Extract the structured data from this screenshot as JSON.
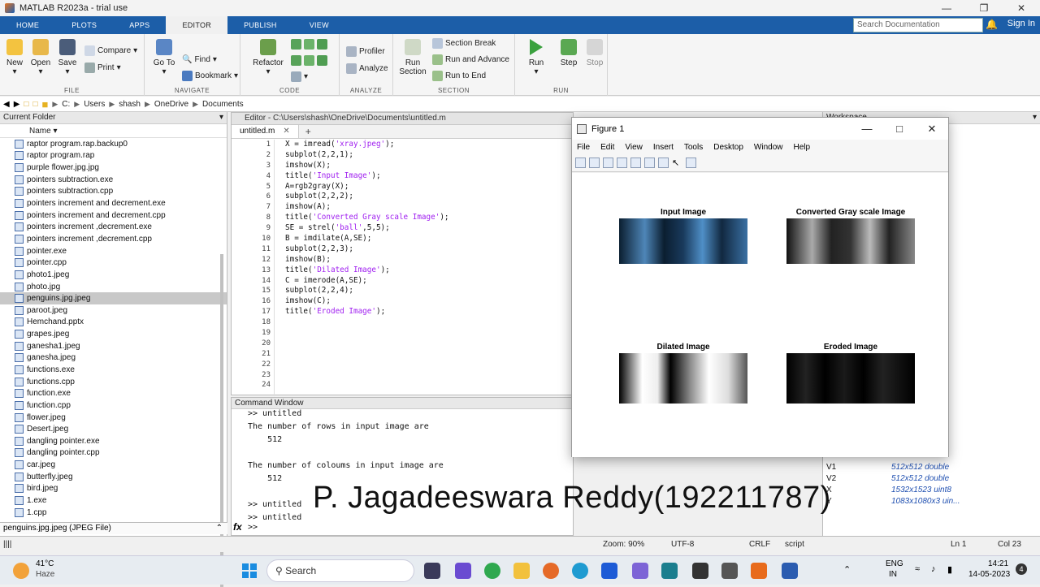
{
  "app": {
    "title": "MATLAB R2023a - trial use"
  },
  "tabs": [
    "HOME",
    "PLOTS",
    "APPS",
    "EDITOR",
    "PUBLISH",
    "VIEW"
  ],
  "search_placeholder": "Search Documentation",
  "sign_in": "Sign In",
  "ribbon": {
    "file": {
      "label": "FILE",
      "new": "New",
      "open": "Open",
      "save": "Save",
      "compare": "Compare",
      "print": "Print"
    },
    "navigate": {
      "label": "NAVIGATE",
      "goto": "Go To",
      "find": "Find",
      "bookmark": "Bookmark"
    },
    "code": {
      "label": "CODE",
      "refactor": "Refactor"
    },
    "analyze": {
      "label": "ANALYZE",
      "profiler": "Profiler",
      "analyze": "Analyze"
    },
    "section": {
      "label": "SECTION",
      "run_section": "Run\nSection",
      "section_break": "Section Break",
      "run_advance": "Run and Advance",
      "run_end": "Run to End"
    },
    "run": {
      "label": "RUN",
      "run": "Run",
      "step": "Step",
      "stop": "Stop"
    }
  },
  "address": [
    "C:",
    "Users",
    "shash",
    "OneDrive",
    "Documents"
  ],
  "current_folder": {
    "title": "Current Folder",
    "col": "Name",
    "files": [
      "raptor program.rap.backup0",
      "raptor program.rap",
      "purple flower.jpg.jpg",
      "pointers subtraction.exe",
      "pointers subtraction.cpp",
      "pointers increment and decrement.exe",
      "pointers increment and decrement.cpp",
      "pointers increment ,decrement.exe",
      "pointers increment ,decrement.cpp",
      "pointer.exe",
      "pointer.cpp",
      "photo1.jpeg",
      "photo.jpg",
      "penguins.jpg.jpeg",
      "paroot.jpeg",
      "Hemchand.pptx",
      "grapes.jpeg",
      "ganesha1.jpeg",
      "ganesha.jpeg",
      "functions.exe",
      "functions.cpp",
      "function.exe",
      "function.cpp",
      "flower.jpeg",
      "Desert.jpeg",
      "dangling pointer.exe",
      "dangling pointer.cpp",
      "car.jpeg",
      "butterfly.jpeg",
      "bird.jpeg",
      "1.exe",
      "1.cpp"
    ],
    "selected": "penguins.jpg.jpeg",
    "detail": "penguins.jpg.jpeg  (JPEG File)"
  },
  "editor": {
    "path": "Editor - C:\\Users\\shash\\OneDrive\\Documents\\untitled.m",
    "tab": "untitled.m",
    "lines": [
      [
        "X = imread(",
        "'xray.jpeg'",
        ");"
      ],
      [
        "subplot(2,2,1);",
        "",
        ""
      ],
      [
        "imshow(X);",
        "",
        ""
      ],
      [
        "title(",
        "'Input Image'",
        ");"
      ],
      [
        "A=rgb2gray(X);",
        "",
        ""
      ],
      [
        "subplot(2,2,2);",
        "",
        ""
      ],
      [
        "imshow(A);",
        "",
        ""
      ],
      [
        "title(",
        "'Converted Gray scale Image'",
        ");"
      ],
      [
        "SE = strel(",
        "'ball'",
        ",5,5);"
      ],
      [
        "B = imdilate(A,SE);",
        "",
        ""
      ],
      [
        "subplot(2,2,3);",
        "",
        ""
      ],
      [
        "imshow(B);",
        "",
        ""
      ],
      [
        "title(",
        "'Dilated Image'",
        ");"
      ],
      [
        "C = imerode(A,SE);",
        "",
        ""
      ],
      [
        "subplot(2,2,4);",
        "",
        ""
      ],
      [
        "imshow(C);",
        "",
        ""
      ],
      [
        "title(",
        "'Eroded Image'",
        ");"
      ],
      [
        "",
        "",
        ""
      ],
      [
        "",
        "",
        ""
      ],
      [
        "",
        "",
        ""
      ],
      [
        "",
        "",
        ""
      ],
      [
        "",
        "",
        ""
      ],
      [
        "",
        "",
        ""
      ],
      [
        "",
        "",
        ""
      ]
    ]
  },
  "command_window": {
    "title": "Command Window",
    "lines": [
      ">> untitled",
      "The number of rows in input image are",
      "    512",
      "",
      "The number of coloums in input image are",
      "    512",
      "",
      ">> untitled",
      ">> untitled"
    ],
    "prompt": ">>"
  },
  "workspace": {
    "title": "Workspace",
    "rows": [
      {
        "name": "V1",
        "value": "512x512 double"
      },
      {
        "name": "V2",
        "value": "512x512 double"
      },
      {
        "name": "X",
        "value": "1532x1523 uint8"
      },
      {
        "name": "Y",
        "value": "1083x1080x3 uin..."
      }
    ]
  },
  "figure": {
    "title": "Figure 1",
    "menu": [
      "File",
      "Edit",
      "View",
      "Insert",
      "Tools",
      "Desktop",
      "Window",
      "Help"
    ],
    "subplots": [
      "Input Image",
      "Converted Gray scale Image",
      "Dilated Image",
      "Eroded Image"
    ]
  },
  "status": {
    "zoom": "Zoom: 90%",
    "encoding": "UTF-8",
    "eol": "CRLF",
    "type": "script",
    "ln": "Ln  1",
    "col": "Col  23"
  },
  "overlay_text": "P. Jagadeeswara Reddy(192211787)",
  "taskbar": {
    "temp": "41°C",
    "weather": "Haze",
    "search": "Search",
    "lang1": "ENG",
    "lang2": "IN",
    "time": "14:21",
    "date": "14-05-2023",
    "badge": "4"
  }
}
